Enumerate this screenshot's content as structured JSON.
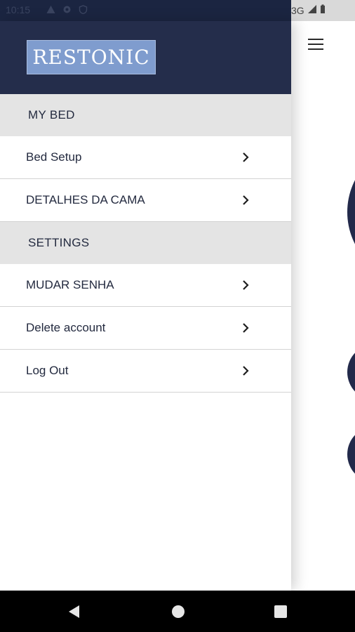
{
  "status_bar": {
    "time": "10:15",
    "network": "3G",
    "left_icons": [
      "warning-icon",
      "settings-notification-icon",
      "shield-icon"
    ],
    "right_icons": [
      "signal-icon",
      "battery-icon"
    ]
  },
  "drawer": {
    "logo_text": "RESTONIC",
    "sections": [
      {
        "title": "MY BED",
        "items": [
          {
            "label": "Bed Setup",
            "icon": "chevron-right-icon"
          },
          {
            "label": "DETALHES DA CAMA",
            "icon": "chevron-right-icon"
          }
        ]
      },
      {
        "title": "SETTINGS",
        "items": [
          {
            "label": "MUDAR SENHA",
            "icon": "chevron-right-icon"
          },
          {
            "label": "Delete account",
            "icon": "chevron-right-icon"
          },
          {
            "label": "Log Out",
            "icon": "chevron-right-icon"
          }
        ]
      }
    ]
  },
  "app": {
    "menu_icon": "hamburger-icon"
  },
  "nav_bar": {
    "buttons": [
      "back-icon",
      "home-icon",
      "recents-icon"
    ]
  },
  "colors": {
    "drawer_header": "#242d4b",
    "logo_bg": "#7f9cce",
    "section_bg": "#e4e4e4",
    "text": "#232a3f",
    "accent_circle": "#22294a"
  }
}
